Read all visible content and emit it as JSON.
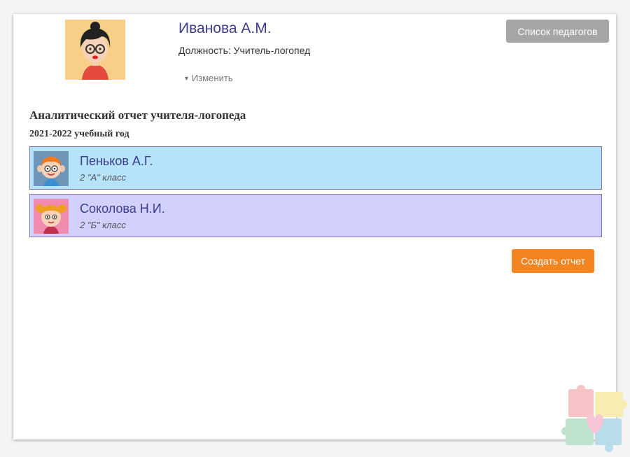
{
  "teacher": {
    "name": "Иванова А.М.",
    "position": "Должность: Учитель-логопед",
    "change_label": "Изменить"
  },
  "header": {
    "teachers_list_button": "Список педагогов"
  },
  "report": {
    "title": "Аналитический отчет учителя-логопеда",
    "school_year": "2021-2022 учебный год"
  },
  "students": [
    {
      "name": "Пеньков А.Г.",
      "class": "2 \"А\" класс",
      "color": "#b4e3fa"
    },
    {
      "name": "Соколова Н.И.",
      "class": "2 \"Б\" класс",
      "color": "#d2d0fc"
    }
  ],
  "actions": {
    "create_report": "Создать отчет"
  },
  "colors": {
    "accent_orange": "#f4841f",
    "name_purple": "#3c3c8c",
    "gray_button": "#a6a6a6"
  }
}
